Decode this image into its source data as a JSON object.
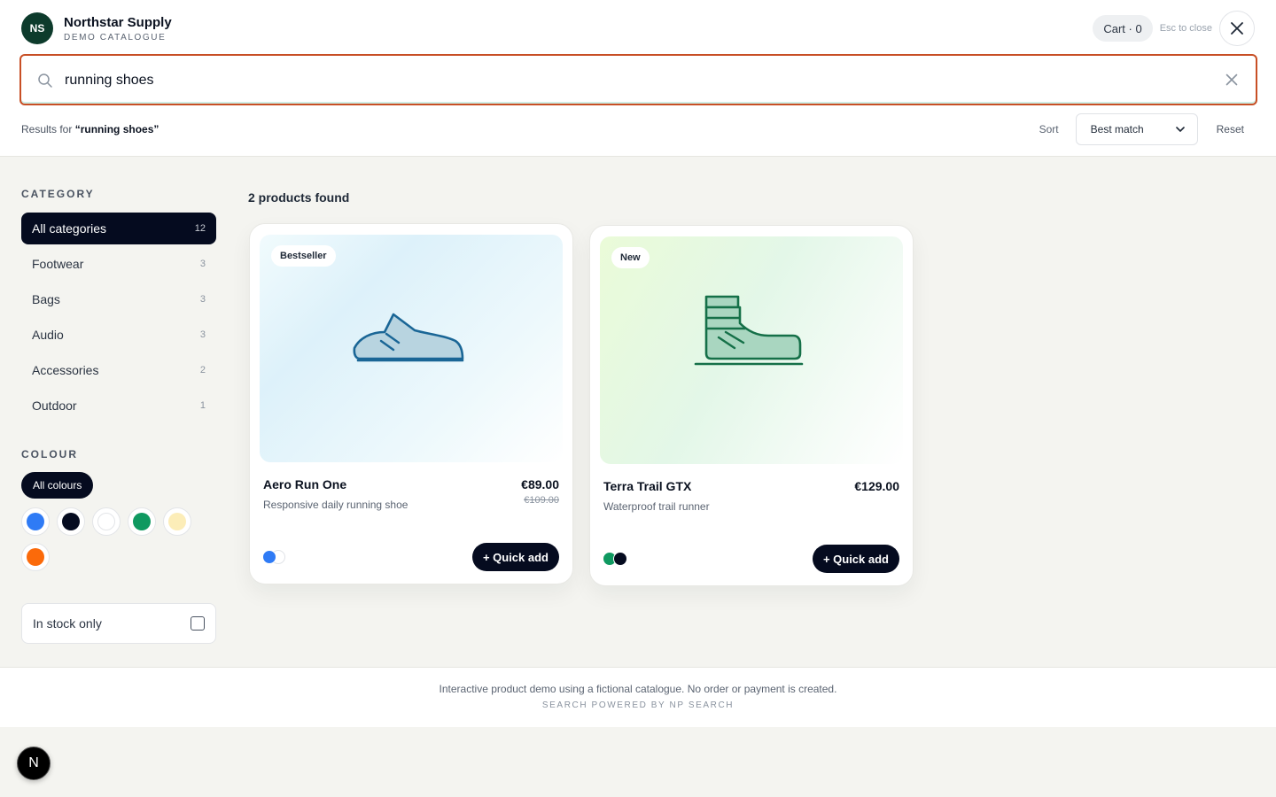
{
  "brand": {
    "initials": "NS",
    "name": "Northstar Supply",
    "subtitle": "DEMO CATALOGUE"
  },
  "header": {
    "cart_label": "Cart · 0",
    "esc_hint": "Esc to close"
  },
  "search": {
    "value": "running shoes",
    "placeholder": ""
  },
  "results": {
    "prefix": "Results for",
    "query_quoted": "“running shoes”",
    "found_label": "2 products found"
  },
  "sort": {
    "label": "Sort",
    "selected": "Best match",
    "reset_label": "Reset"
  },
  "filters": {
    "category_title": "CATEGORY",
    "categories": [
      {
        "label": "All categories",
        "count": "12",
        "active": true
      },
      {
        "label": "Footwear",
        "count": "3"
      },
      {
        "label": "Bags",
        "count": "3"
      },
      {
        "label": "Audio",
        "count": "3"
      },
      {
        "label": "Accessories",
        "count": "2"
      },
      {
        "label": "Outdoor",
        "count": "1"
      }
    ],
    "colour_title": "COLOUR",
    "all_colours_label": "All colours",
    "colours": [
      "#2f7bf5",
      "#050b1f",
      "#ffffff",
      "#0f9960",
      "#fcedb8",
      "#fb6a0a"
    ],
    "in_stock_label": "In stock only",
    "in_stock_checked": false
  },
  "products": [
    {
      "badge": "Bestseller",
      "name": "Aero Run One",
      "description": "Responsive daily running shoe",
      "price": "€89.00",
      "old_price": "€109.00",
      "colours": [
        "#2f7bf5",
        "#ffffff"
      ],
      "cta": "+ Quick add",
      "icon": "sneaker-icon"
    },
    {
      "badge": "New",
      "name": "Terra Trail GTX",
      "description": "Waterproof trail runner",
      "price": "€129.00",
      "old_price": "",
      "colours": [
        "#0f9960",
        "#050b1f"
      ],
      "cta": "+ Quick add",
      "icon": "boot-icon"
    }
  ],
  "footer": {
    "note": "Interactive product demo using a fictional catalogue. No order or payment is created.",
    "powered": "SEARCH POWERED BY NP SEARCH"
  },
  "dev_badge": {
    "label": "N"
  }
}
